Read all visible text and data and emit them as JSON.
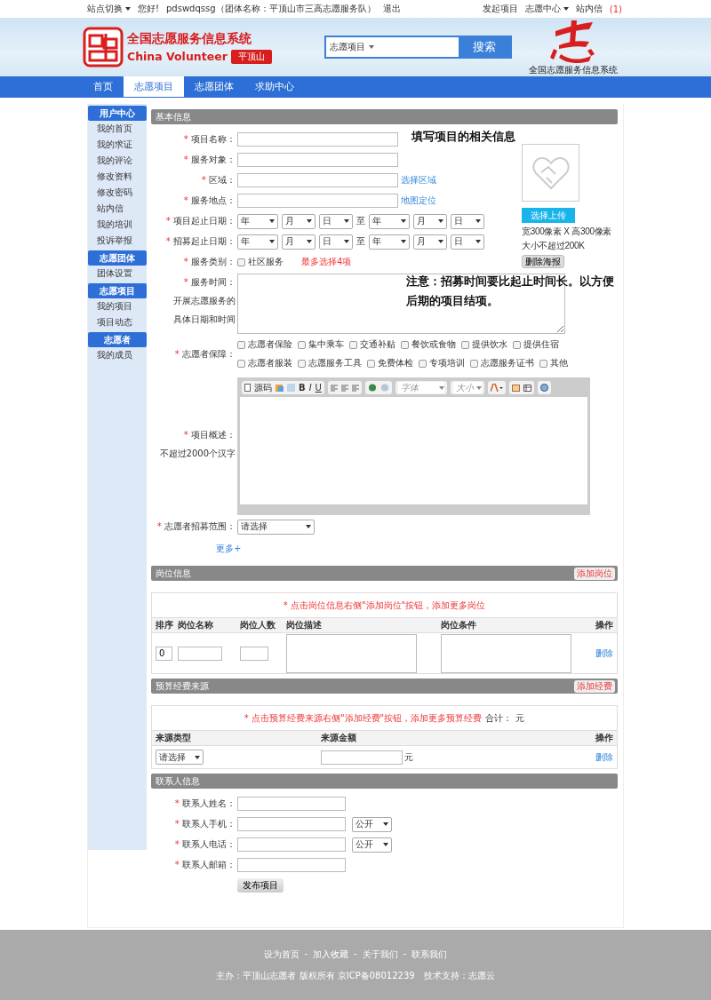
{
  "top_bar": {
    "site_switch": "站点切换",
    "greeting": "您好!",
    "user": "pdswdqssg（团体名称：平顶山市三高志愿服务队）",
    "logout": "退出",
    "links": [
      "发起项目",
      "志愿中心"
    ],
    "inbox": "站内信",
    "inbox_count": "(1)"
  },
  "header": {
    "title": "全国志愿服务信息系统",
    "subtitle": "China Volunteer",
    "city": "平顶山",
    "search_category": "志愿项目",
    "search_button": "搜索",
    "right_caption": "全国志愿服务信息系统"
  },
  "nav": [
    {
      "label": "首页",
      "selected": false
    },
    {
      "label": "志愿项目",
      "selected": true
    },
    {
      "label": "志愿团体",
      "selected": false
    },
    {
      "label": "求助中心",
      "selected": false
    }
  ],
  "sidebar": [
    {
      "title": "用户中心",
      "items": [
        "我的首页",
        "我的求证",
        "我的评论",
        "修改资料",
        "修改密码",
        "站内信",
        "我的培训",
        "投诉举报"
      ]
    },
    {
      "title": "志愿团体",
      "items": [
        "团体设置"
      ]
    },
    {
      "title": "志愿项目",
      "items": [
        "我的项目",
        "项目动态"
      ]
    },
    {
      "title": "志愿者",
      "items": [
        "我的成员"
      ]
    }
  ],
  "basic_info": {
    "title": "基本信息",
    "mark": "*",
    "rows": [
      {
        "kind": "text",
        "label": "项目名称："
      },
      {
        "kind": "text",
        "label": "服务对象："
      },
      {
        "kind": "text",
        "label": "区域：",
        "link": "选择区域"
      },
      {
        "kind": "text",
        "label": "服务地点：",
        "link": "地图定位"
      },
      {
        "kind": "dates",
        "label": "项目起止日期：",
        "start": [
          "年",
          "月",
          "日"
        ],
        "separator": "至",
        "end": [
          "年",
          "月",
          "日"
        ]
      },
      {
        "kind": "dates",
        "label": "招募起止日期：",
        "start": [
          "年",
          "月",
          "日"
        ],
        "separator": "至",
        "end": [
          "年",
          "月",
          "日"
        ]
      },
      {
        "kind": "checks",
        "label": "服务类别：",
        "options": [
          {
            "label": "社区服务",
            "checked": false
          }
        ],
        "hint": "最多选择4项"
      },
      {
        "kind": "textarea",
        "label": "服务时间：",
        "notes": [
          "开展志愿服务的",
          "具体日期和时间"
        ]
      },
      {
        "kind": "checks",
        "label": "志愿者保障：",
        "options": [
          {
            "label": "志愿者保险",
            "checked": false
          },
          {
            "label": "集中乘车",
            "checked": false
          },
          {
            "label": "交通补贴",
            "checked": false
          },
          {
            "label": "餐饮或食物",
            "checked": false
          },
          {
            "label": "提供饮水",
            "checked": false
          },
          {
            "label": "提供住宿",
            "checked": false
          },
          {
            "label": "志愿者服装",
            "checked": false
          },
          {
            "label": "志愿服务工具",
            "checked": false
          },
          {
            "label": "免费体检",
            "checked": false
          },
          {
            "label": "专项培训",
            "checked": false
          },
          {
            "label": "志愿服务证书",
            "checked": false
          },
          {
            "label": "其他",
            "checked": false
          }
        ]
      },
      {
        "kind": "editor",
        "label": "项目概述：",
        "notes": [
          "不超过2000个汉字"
        ],
        "toolbar": {
          "source": "源码",
          "bold": "B",
          "italic": "I",
          "underline": "U",
          "font": "字体",
          "size": "大小"
        }
      },
      {
        "kind": "select",
        "label": "志愿者招募范围：",
        "value": "请选择"
      }
    ],
    "more": "更多+",
    "note_top": "填写项目的相关信息",
    "note_bottom": "注意：招募时间要比起止时间长。以方便后期的项目结项。",
    "poster": {
      "upload": "选择上传",
      "spec": [
        "宽300像素 X 高300像素",
        "大小不超过200K"
      ],
      "delete": "删除海报"
    }
  },
  "positions": {
    "title": "岗位信息",
    "add": "添加岗位",
    "notice": "* 点击岗位信息右侧\"添加岗位\"按钮，添加更多岗位",
    "columns": [
      "排序",
      "岗位名称",
      "岗位人数",
      "岗位描述",
      "岗位条件",
      "操作"
    ],
    "rows": [
      {
        "order": "0",
        "action": "删除"
      }
    ]
  },
  "budget": {
    "title": "预算经费来源",
    "add": "添加经费",
    "notice": "* 点击预算经费来源右侧\"添加经费\"按钮，添加更多预算经费",
    "total": "合计：",
    "total_unit": "元",
    "columns": [
      "来源类型",
      "来源金额",
      "操作"
    ],
    "rows": [
      {
        "type": "请选择",
        "unit": "元",
        "action": "删除"
      }
    ]
  },
  "contact": {
    "title": "联系人信息",
    "mark": "*",
    "rows": [
      {
        "label": "联系人姓名："
      },
      {
        "label": "联系人手机：",
        "visibility": "公开"
      },
      {
        "label": "联系人电话：",
        "visibility": "公开"
      },
      {
        "label": "联系人邮箱："
      }
    ],
    "submit": "发布项目"
  },
  "footer": {
    "links": [
      "设为首页",
      "加入收藏",
      "关于我们",
      "联系我们"
    ],
    "separator": "-",
    "credits": "主办：平顶山志愿者 版权所有 京ICP备08012239　技术支持：志愿云"
  }
}
